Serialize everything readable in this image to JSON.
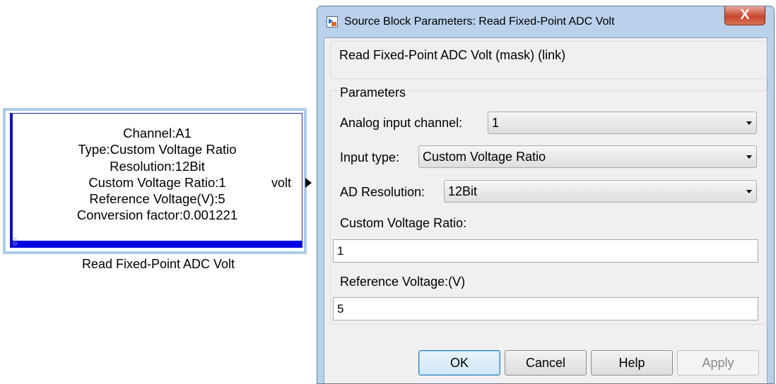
{
  "block": {
    "lines": [
      "Channel:A1",
      "Type:Custom Voltage Ratio",
      "Resolution:12Bit",
      "Custom Voltage Ratio:1",
      "Reference Voltage(V):5",
      "Conversion factor:0.001221"
    ],
    "output_port_label": "volt",
    "caption": "Read Fixed-Point ADC Volt",
    "port_icon": "down-arrow-icon"
  },
  "dialog": {
    "title": "Source Block Parameters: Read Fixed-Point ADC Volt",
    "close_label": "X",
    "header": "Read Fixed-Point ADC Volt (mask) (link)",
    "group_title": "Parameters",
    "analog_input_channel": {
      "label": "Analog input channel:",
      "value": "1"
    },
    "input_type": {
      "label": "Input type:",
      "value": "Custom Voltage Ratio"
    },
    "ad_resolution": {
      "label": "AD Resolution:",
      "value": "12Bit"
    },
    "custom_voltage_ratio": {
      "label": "Custom Voltage Ratio:",
      "value": "1"
    },
    "reference_voltage": {
      "label": "Reference Voltage:(V)",
      "value": "5"
    },
    "buttons": {
      "ok": "OK",
      "cancel": "Cancel",
      "help": "Help",
      "apply": "Apply"
    }
  },
  "colors": {
    "block_border": "#0000e0",
    "dialog_frame": "#b9d1ea",
    "close_button": "#c8452c"
  }
}
